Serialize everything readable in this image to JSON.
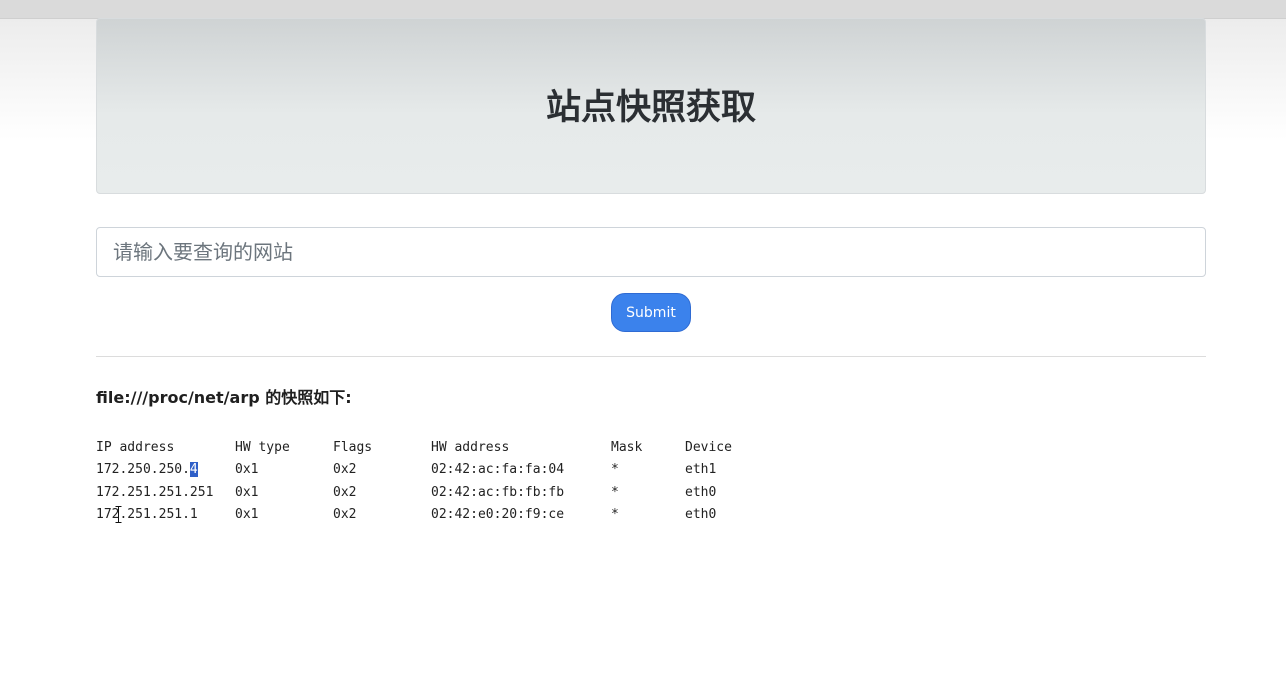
{
  "header": {
    "title": "站点快照获取"
  },
  "search": {
    "placeholder": "请输入要查询的网站",
    "value": ""
  },
  "form": {
    "submit_label": "Submit"
  },
  "result": {
    "title": "file:///proc/net/arp 的快照如下:",
    "columns": [
      "IP address",
      "HW type",
      "Flags",
      "HW address",
      "Mask",
      "Device"
    ],
    "rows": [
      {
        "ip": "172.250.250.4",
        "ip_prefix": "172.250.250.",
        "ip_selected": "4",
        "hw_type": "0x1",
        "flags": "0x2",
        "hw_address": "02:42:ac:fa:fa:04",
        "mask": "*",
        "device": "eth1"
      },
      {
        "ip": "172.251.251.251",
        "hw_type": "0x1",
        "flags": "0x2",
        "hw_address": "02:42:ac:fb:fb:fb",
        "mask": "*",
        "device": "eth0"
      },
      {
        "ip": "172.251.251.1",
        "hw_type": "0x1",
        "flags": "0x2",
        "hw_address": "02:42:e0:20:f9:ce",
        "mask": "*",
        "device": "eth0"
      }
    ]
  },
  "colors": {
    "submit_bg": "#3b82ec",
    "selection": "#2f5fc8"
  }
}
